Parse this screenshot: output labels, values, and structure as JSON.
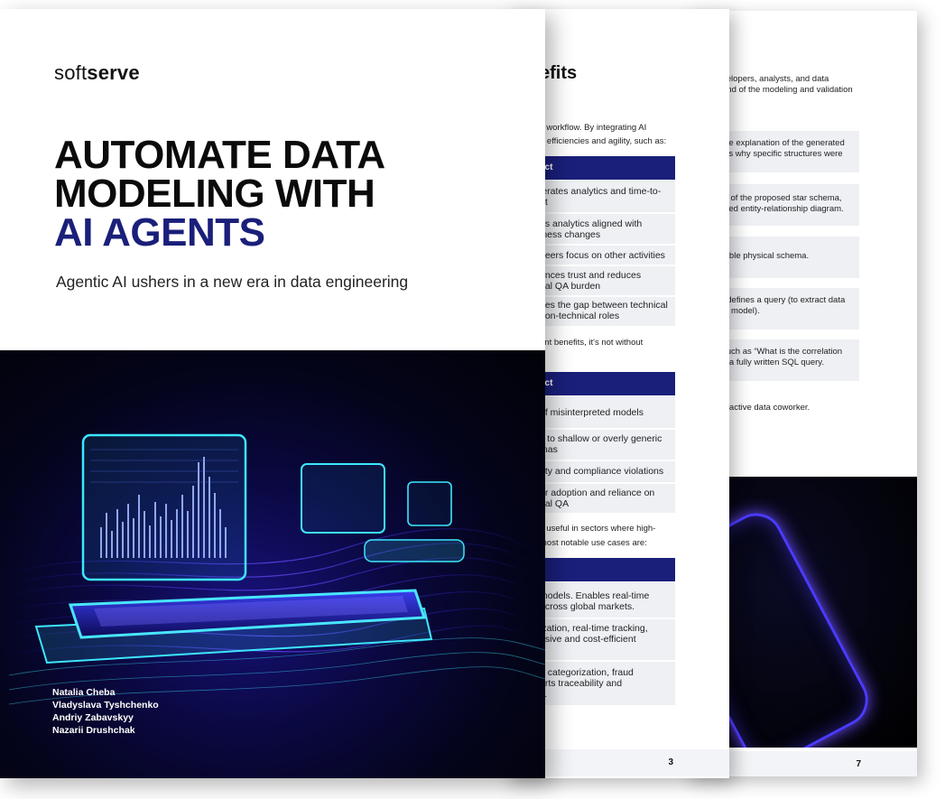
{
  "back_page": {
    "intro_lines": [
      "velopers, analysts, and data",
      "end of the modeling and validation"
    ],
    "boxes": [
      [
        "ple explanation of the generated",
        "ins why specific structures were"
      ],
      [
        "w of the proposed star schema,",
        "itted entity-relationship diagram."
      ],
      [
        "table physical schema."
      ],
      [
        "t defines a query (to extract data",
        "al model)."
      ],
      [
        "such as “What is the correlation",
        "o a fully written SQL query."
      ]
    ],
    "closing": "n active data coworker.",
    "page_number": "7"
  },
  "middle_page": {
    "heading": "efits",
    "intro_lines": [
      "s workflow. By integrating AI",
      "e efficiencies and agility, such as:"
    ],
    "table1_header": "act",
    "table1_rows": [
      "lerates analytics and time-to-\nht",
      "ps analytics aligned with\niness changes",
      "neers focus on other activities",
      "ances trust and reduces\nual QA burden",
      "ges the gap between technical\nnon-technical roles"
    ],
    "mid_lines": [
      "ant benefits, it's not without"
    ],
    "table2_header": "act",
    "table2_rows": [
      "of misinterpreted models",
      "s to shallow or overly generic\nmas",
      "rity and compliance violations",
      "er adoption and reliance on\nual QA"
    ],
    "use_case_lines": [
      "y useful in sectors where high-",
      "most notable use cases are:"
    ],
    "table3_rows": [
      "models. Enables real-time\nacross global markets.",
      "ization, real-time tracking,\nnsive and cost-efficient",
      "n categorization, fraud\norts traceability and\ns."
    ],
    "page_number": "3"
  },
  "cover": {
    "logo_light": "soft",
    "logo_bold": "serve",
    "title_lines": [
      "AUTOMATE DATA",
      "MODELING WITH"
    ],
    "title_accent": "AI AGENTS",
    "subtitle": "Agentic AI ushers in a new era in data engineering",
    "authors": [
      "Natalia Cheba",
      "Vladyslava Tyshchenko",
      "Andriy Zabavskyy",
      "Nazarii Drushchak"
    ]
  },
  "colors": {
    "accent_navy": "#1a1f7a",
    "neon_cyan": "#3de7ff",
    "neon_violet": "#6e4dff"
  }
}
